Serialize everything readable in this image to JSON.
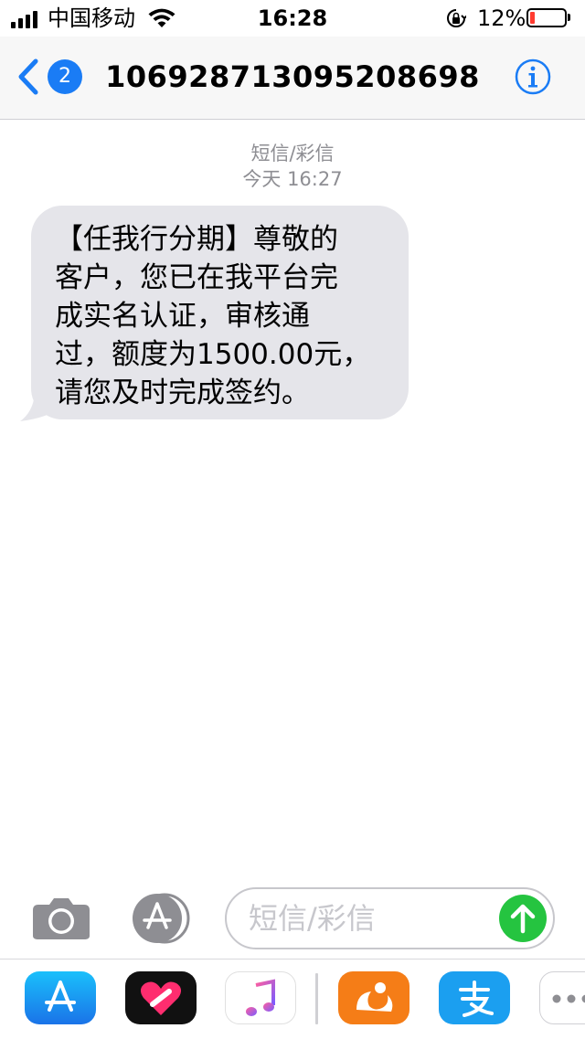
{
  "status_bar": {
    "carrier": "中国移动",
    "time": "16:28",
    "battery_percent": "12%",
    "battery_level": 0.12,
    "signal_bars": 4,
    "colors": {
      "battery_low": "#ff3b30"
    }
  },
  "nav": {
    "back_badge": "2",
    "title": "10692871309520869​8",
    "icons": {
      "back": "chevron-left-icon",
      "info": "info-circle-icon"
    },
    "accent": "#1a7cf5"
  },
  "conversation": {
    "service_label": "短信/彩信",
    "timestamp": "今天 16:27",
    "messages": [
      {
        "direction": "incoming",
        "lines": [
          "【任我行分期】尊敬的",
          "客户，您已在我平台完",
          "成实名认证，审核通",
          "过，额度为1500.00元，",
          "请您及时完成签约。"
        ]
      }
    ],
    "bubble_color": "#e5e5ea"
  },
  "composer": {
    "placeholder": "短信/彩信",
    "icons": {
      "camera": "camera-icon",
      "apps": "app-store-icon",
      "send": "send-arrow-icon"
    },
    "send_color": "#25c440"
  },
  "app_drawer": {
    "apps": [
      {
        "name": "app-store-icon"
      },
      {
        "name": "digital-touch-icon"
      },
      {
        "name": "music-icon"
      },
      {
        "name": "uc-browser-icon"
      },
      {
        "name": "alipay-icon"
      },
      {
        "name": "more-apps-icon"
      }
    ]
  }
}
